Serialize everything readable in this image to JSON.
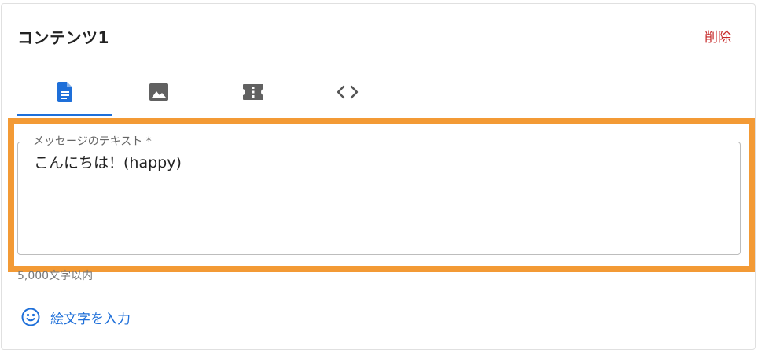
{
  "header": {
    "title": "コンテンツ1",
    "delete_label": "削除"
  },
  "tabs": [
    {
      "icon": "document-icon",
      "active": true
    },
    {
      "icon": "image-icon",
      "active": false
    },
    {
      "icon": "coupon-icon",
      "active": false
    },
    {
      "icon": "code-icon",
      "active": false
    }
  ],
  "message_field": {
    "label": "メッセージのテキスト *",
    "value": "こんにちは！(happy)",
    "helper": "5,000文字以内"
  },
  "emoji_button": {
    "icon": "smiley-icon",
    "label": "絵文字を入力"
  },
  "colors": {
    "accent": "#1e6fd9",
    "delete": "#c62828",
    "highlight": "#f39a35"
  }
}
